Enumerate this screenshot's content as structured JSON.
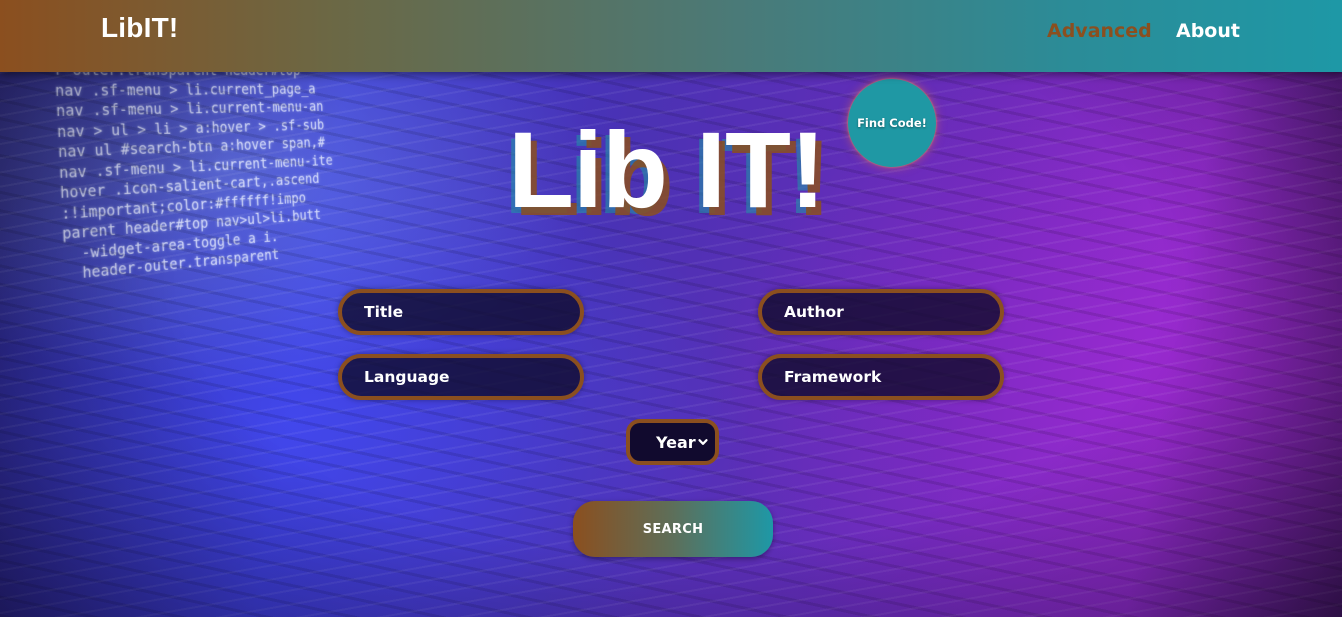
{
  "nav": {
    "brand": "LibIT!",
    "links": [
      {
        "label": "Advanced",
        "color": "#8b4f1f"
      },
      {
        "label": "About",
        "color": "#ffffff"
      }
    ]
  },
  "hero": {
    "title": "Lib IT!",
    "badge": "Find Code!"
  },
  "form": {
    "title_placeholder": "Title",
    "author_placeholder": "Author",
    "language_placeholder": "Language",
    "framework_placeholder": "Framework",
    "year_selected": "Year",
    "year_icon": "chevron-down-icon",
    "search_label": "SEARCH"
  },
  "colors": {
    "accent_brown": "#8b4f1f",
    "accent_teal": "#1e98a6",
    "field_bg": "#110a2e"
  },
  "background_code": [
    "r-outer.transparent header#top",
    "nav .sf-menu > li.current_page_a",
    "nav .sf-menu > li.current-menu-an",
    "nav > ul > li > a:hover > .sf-sub",
    "nav ul #search-btn a:hover span,#",
    "nav .sf-menu > li.current-menu-ite",
    "hover .icon-salient-cart,.ascend",
    ":!important;color:#ffffff!impo",
    "parent header#top nav>ul>li.butt",
    "  -widget-area-toggle a i.",
    "  header-outer.transparent"
  ]
}
